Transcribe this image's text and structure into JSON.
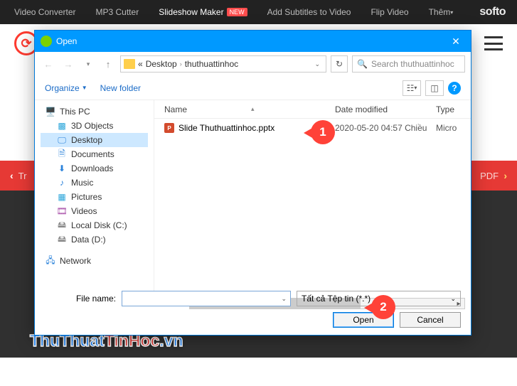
{
  "topnav": {
    "tabs": [
      "Video Converter",
      "MP3 Cutter",
      "Slideshow Maker",
      "Add Subtitles to Video",
      "Flip Video",
      "Thêm"
    ],
    "active_index": 2,
    "new_badge": "NEW",
    "brand": "softo"
  },
  "red_bar": {
    "left": "Tr",
    "right": "PDF"
  },
  "watermark": {
    "a": "ThuThuat",
    "b": "TinHoc",
    "c": ".vn"
  },
  "dialog": {
    "title": "Open",
    "path": {
      "prefix": "«",
      "seg1": "Desktop",
      "seg2": "thuthuattinhoc"
    },
    "search_placeholder": "Search thuthuattinhoc",
    "toolbar": {
      "organize": "Organize",
      "new_folder": "New folder"
    },
    "tree": [
      {
        "label": "This PC",
        "icon": "pc",
        "child": false
      },
      {
        "label": "3D Objects",
        "icon": "3d",
        "child": true
      },
      {
        "label": "Desktop",
        "icon": "desk",
        "child": true,
        "selected": true
      },
      {
        "label": "Documents",
        "icon": "doc",
        "child": true
      },
      {
        "label": "Downloads",
        "icon": "dl",
        "child": true
      },
      {
        "label": "Music",
        "icon": "music",
        "child": true
      },
      {
        "label": "Pictures",
        "icon": "pic",
        "child": true
      },
      {
        "label": "Videos",
        "icon": "vid",
        "child": true
      },
      {
        "label": "Local Disk (C:)",
        "icon": "disk",
        "child": true
      },
      {
        "label": "Data (D:)",
        "icon": "disk",
        "child": true
      },
      {
        "label": "Network",
        "icon": "net",
        "child": false
      }
    ],
    "columns": {
      "name": "Name",
      "date": "Date modified",
      "type": "Type"
    },
    "files": [
      {
        "name": "Slide Thuthuattinhoc.pptx",
        "date": "2020-05-20 04:57 Chiều",
        "type": "Micro"
      }
    ],
    "file_name_label": "File name:",
    "filter": "Tất cả Tệp tin (*.*)",
    "open": "Open",
    "cancel": "Cancel"
  },
  "annotations": {
    "one": "1",
    "two": "2"
  }
}
